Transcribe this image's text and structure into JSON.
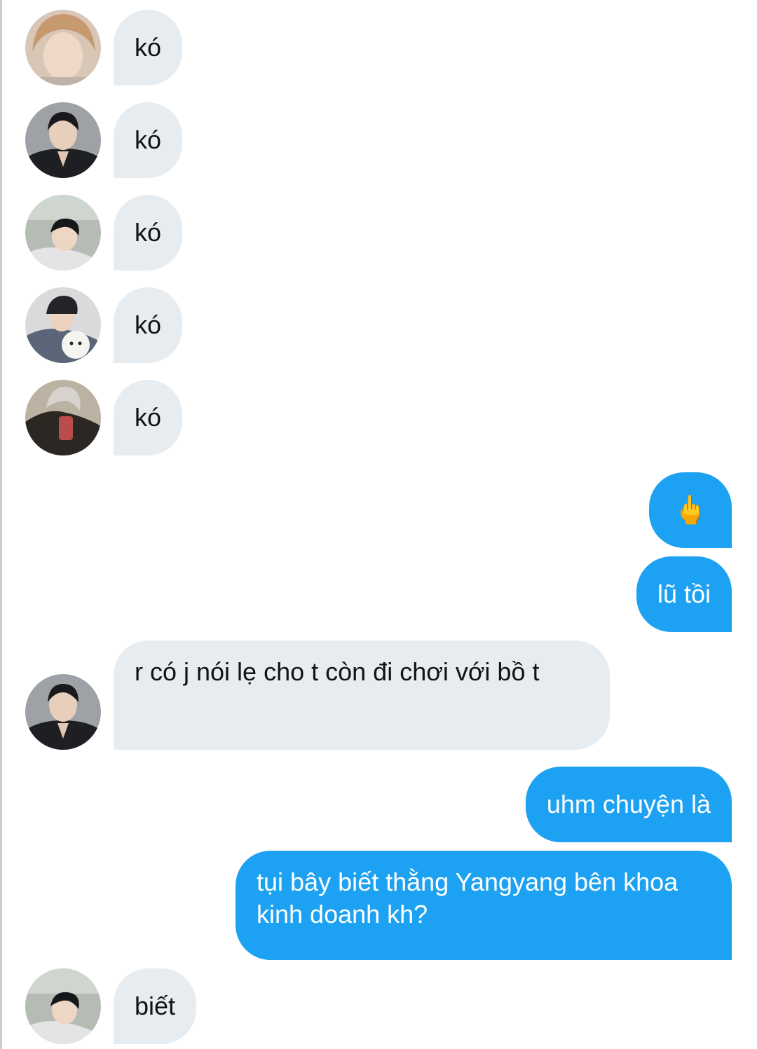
{
  "colors": {
    "incoming_bubble": "#e6ecf0",
    "outgoing_bubble": "#1da1f2",
    "incoming_text": "#0f1419",
    "outgoing_text": "#ffffff"
  },
  "messages": [
    {
      "side": "incoming",
      "text": "kó",
      "avatar": "avatar-icon"
    },
    {
      "side": "incoming",
      "text": "kó",
      "avatar": "avatar-icon"
    },
    {
      "side": "incoming",
      "text": "kó",
      "avatar": "avatar-icon"
    },
    {
      "side": "incoming",
      "text": "kó",
      "avatar": "avatar-icon"
    },
    {
      "side": "incoming",
      "text": "kó",
      "avatar": "avatar-icon"
    },
    {
      "side": "outgoing",
      "text": "🖕"
    },
    {
      "side": "outgoing",
      "text": "lũ tồi"
    },
    {
      "side": "incoming",
      "text": "r có j nói lẹ cho t còn đi chơi với bồ t",
      "avatar": "avatar-icon"
    },
    {
      "side": "outgoing",
      "text": "uhm chuyện là"
    },
    {
      "side": "outgoing",
      "text": "tụi bây biết thằng Yangyang bên khoa kinh doanh kh?"
    },
    {
      "side": "incoming",
      "text": "biết",
      "avatar": "avatar-icon"
    }
  ]
}
